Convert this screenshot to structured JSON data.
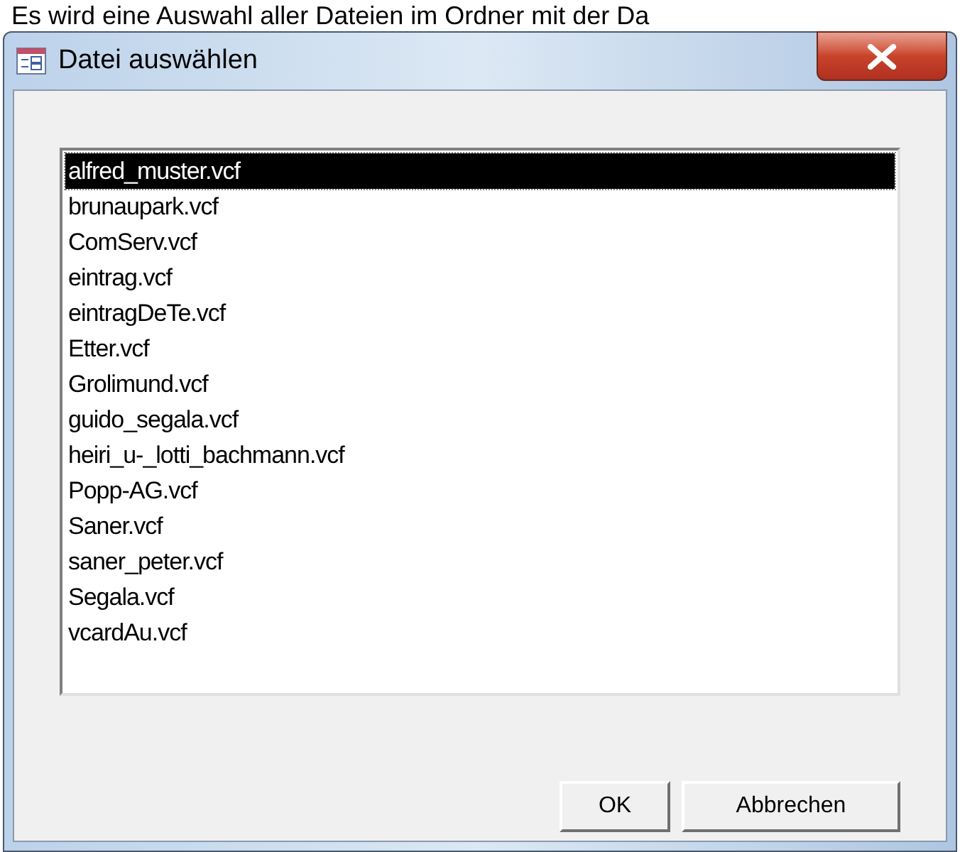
{
  "background_text": "Es wird eine Auswahl aller Dateien im Ordner mit der Da",
  "window": {
    "title": "Datei auswählen"
  },
  "files": [
    {
      "label": "alfred_muster.vcf",
      "selected": true
    },
    {
      "label": "brunaupark.vcf",
      "selected": false
    },
    {
      "label": "ComServ.vcf",
      "selected": false
    },
    {
      "label": "eintrag.vcf",
      "selected": false
    },
    {
      "label": "eintragDeTe.vcf",
      "selected": false
    },
    {
      "label": "Etter.vcf",
      "selected": false
    },
    {
      "label": "Grolimund.vcf",
      "selected": false
    },
    {
      "label": "guido_segala.vcf",
      "selected": false
    },
    {
      "label": "heiri_u-_lotti_bachmann.vcf",
      "selected": false
    },
    {
      "label": "Popp-AG.vcf",
      "selected": false
    },
    {
      "label": "Saner.vcf",
      "selected": false
    },
    {
      "label": "saner_peter.vcf",
      "selected": false
    },
    {
      "label": "Segala.vcf",
      "selected": false
    },
    {
      "label": "vcardAu.vcf",
      "selected": false
    }
  ],
  "buttons": [
    "OK",
    "Abbrechen"
  ]
}
